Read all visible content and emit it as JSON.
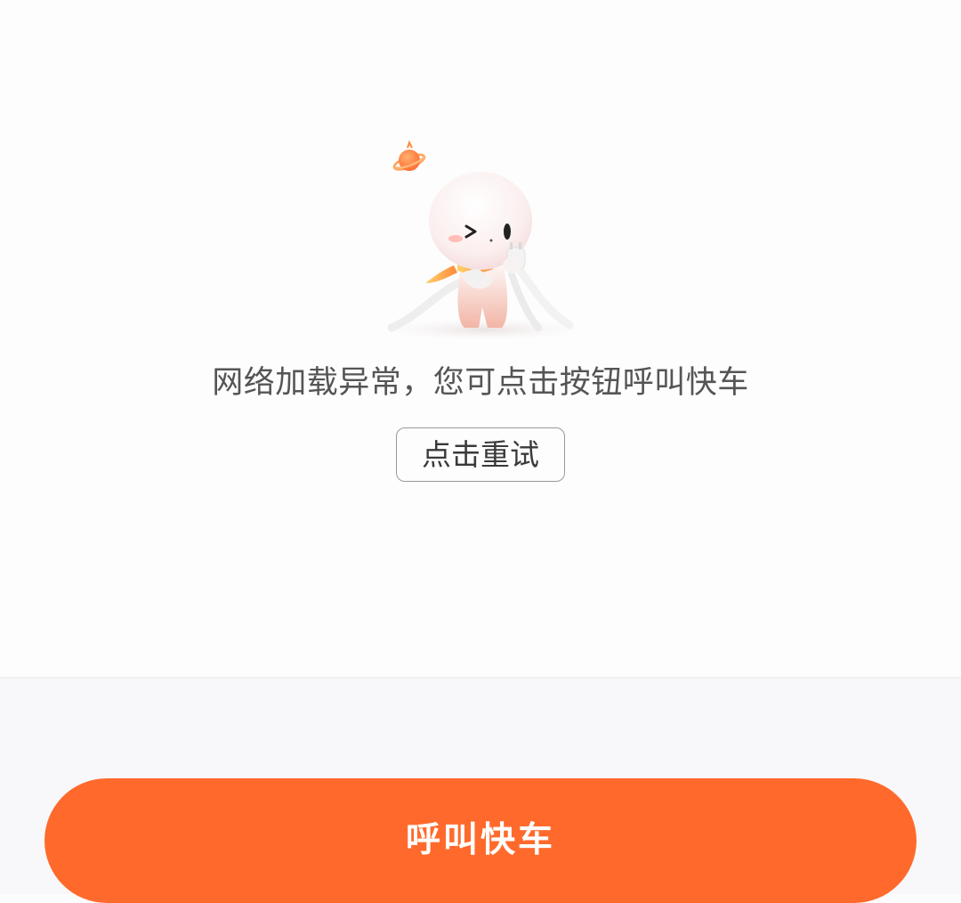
{
  "status": {
    "message": "网络加载异常，您可点击按钮呼叫快车",
    "retry_label": "点击重试"
  },
  "primary_action": {
    "label": "呼叫快车"
  },
  "colors": {
    "accent": "#ff6a2c",
    "background": "#fdfdfd",
    "bottom_bar": "#f8f8fa",
    "message_text": "#555555"
  },
  "illustration": {
    "icon": "mascot-holding-cable-icon"
  }
}
